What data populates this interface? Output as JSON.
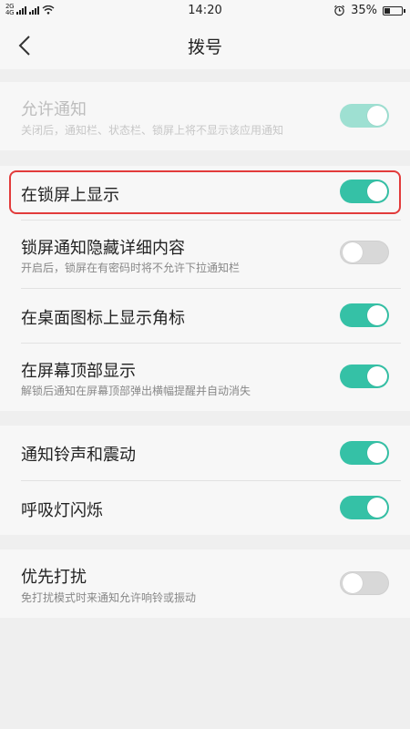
{
  "status_bar": {
    "network_top": "2G",
    "network_bottom": "4G",
    "time": "14:20",
    "battery_percent": "35%",
    "battery_level": 0.35,
    "icons": [
      "signal-icon",
      "wifi-icon",
      "alarm-icon",
      "battery-icon"
    ]
  },
  "header": {
    "title": "拨号",
    "back_icon": "chevron-left-icon"
  },
  "settings": {
    "allow_notify": {
      "label": "允许通知",
      "desc": "关闭后，通知栏、状态栏、锁屏上将不显示该应用通知",
      "on": true,
      "disabled": true
    },
    "lockscreen_show": {
      "label": "在锁屏上显示",
      "on": true
    },
    "lockscreen_hide_detail": {
      "label": "锁屏通知隐藏详细内容",
      "desc": "开启后，锁屏在有密码时将不允许下拉通知栏",
      "on": false
    },
    "badge": {
      "label": "在桌面图标上显示角标",
      "on": true
    },
    "top_banner": {
      "label": "在屏幕顶部显示",
      "desc": "解锁后通知在屏幕顶部弹出横幅提醒并自动消失",
      "on": true
    },
    "ringtone_vibrate": {
      "label": "通知铃声和震动",
      "on": true
    },
    "breathing_light": {
      "label": "呼吸灯闪烁",
      "on": true
    },
    "dnd_priority": {
      "label": "优先打扰",
      "desc": "免打扰模式时来通知允许响铃或振动",
      "on": false
    }
  },
  "colors": {
    "accent": "#35c1a6",
    "highlight_border": "#e23b3b",
    "background": "#efefef"
  }
}
